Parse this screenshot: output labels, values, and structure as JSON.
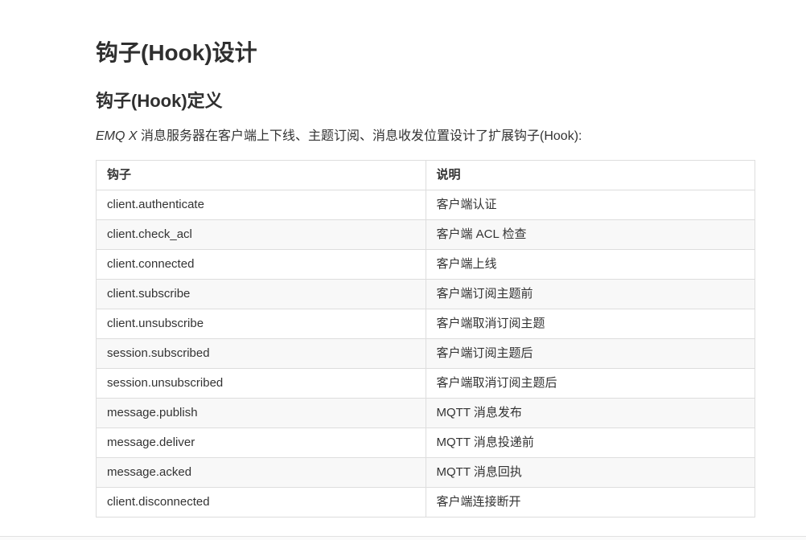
{
  "article": {
    "title": "钩子(Hook)设计",
    "section_heading": "钩子(Hook)定义",
    "intro_emphasis": "EMQ X",
    "intro_text": " 消息服务器在客户端上下线、主题订阅、消息收发位置设计了扩展钩子(Hook):"
  },
  "table": {
    "headers": [
      "钩子",
      "说明"
    ],
    "rows": [
      [
        "client.authenticate",
        "客户端认证"
      ],
      [
        "client.check_acl",
        "客户端 ACL 检查"
      ],
      [
        "client.connected",
        "客户端上线"
      ],
      [
        "client.subscribe",
        "客户端订阅主题前"
      ],
      [
        "client.unsubscribe",
        "客户端取消订阅主题"
      ],
      [
        "session.subscribed",
        "客户端订阅主题后"
      ],
      [
        "session.unsubscribed",
        "客户端取消订阅主题后"
      ],
      [
        "message.publish",
        "MQTT 消息发布"
      ],
      [
        "message.deliver",
        "MQTT 消息投递前"
      ],
      [
        "message.acked",
        "MQTT 消息回执"
      ],
      [
        "client.disconnected",
        "客户端连接断开"
      ]
    ]
  },
  "colors": {
    "text": "#333333",
    "heading": "#2f2f2f",
    "table_border": "#dddddd",
    "row_stripe": "#f8f8f8",
    "bottom_strip_bg": "#fafafa",
    "bottom_strip_border": "#e2e2e2"
  }
}
